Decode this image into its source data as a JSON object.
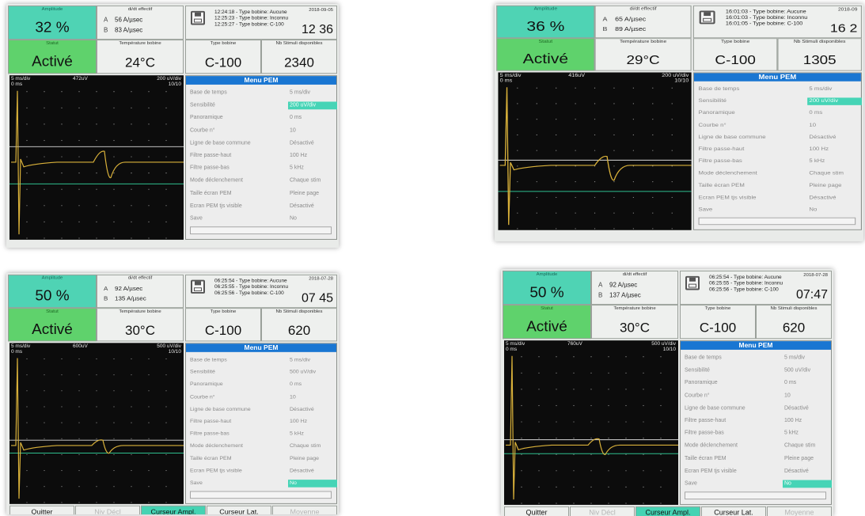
{
  "photos": [
    {
      "amplitude_label": "Amplitude",
      "amplitude_value": "32 %",
      "didt_label": "di/dt effectif",
      "didt_a_label": "A",
      "didt_a_value": "56 A/µsec",
      "didt_b_label": "B",
      "didt_b_value": "83 A/µsec",
      "log_lines": [
        "12:24:18 - Type bobine: Aucune",
        "12:25:23 - Type bobine: Inconnu",
        "12:25:27 - Type bobine: C-100"
      ],
      "log_date": "2018-09-05",
      "log_time": "12 36",
      "statut_label": "Statut",
      "statut_value": "Activé",
      "temp_label": "Température bobine",
      "temp_value": "24°C",
      "coil_label": "Type bobine",
      "coil_value": "C-100",
      "stimuli_label": "Nb Stimuli disponibles",
      "stimuli_value": "2340",
      "scope_timebase": "5 ms/div",
      "scope_zero": "0 ms",
      "scope_peak": "472uV",
      "scope_sens": "200 uV/div",
      "scope_count": "10/10",
      "menu_title": "Menu PEM",
      "menu_rows": [
        {
          "label": "Base de temps",
          "value": "5 ms/div"
        },
        {
          "label": "Sensibilité",
          "value": "200 uV/div"
        },
        {
          "label": "Panoramique",
          "value": "0 ms"
        },
        {
          "label": "Courbe n°",
          "value": "10"
        },
        {
          "label": "Ligne de base commune",
          "value": "Désactivé"
        },
        {
          "label": "Filtre passe-haut",
          "value": "100 Hz"
        },
        {
          "label": "Filtre passe-bas",
          "value": "5 kHz"
        },
        {
          "label": "Mode déclenchement",
          "value": "Chaque stim"
        },
        {
          "label": "Taille écran PEM",
          "value": "Pleine page"
        },
        {
          "label": "Ecran PEM tjs visible",
          "value": "Désactivé"
        },
        {
          "label": "Save",
          "value": "No"
        }
      ],
      "highlight_row": 1,
      "softkeys": []
    },
    {
      "amplitude_label": "Amplitude",
      "amplitude_value": "36 %",
      "didt_label": "di/dt effectif",
      "didt_a_label": "A",
      "didt_a_value": "65 A/µsec",
      "didt_b_label": "B",
      "didt_b_value": "89 A/µsec",
      "log_lines": [
        "16:01:03 - Type bobine: Aucune",
        "16:01:03 - Type bobine: Inconnu",
        "16:01:05 - Type bobine: C-100"
      ],
      "log_date": "2018-09",
      "log_time": "16 2",
      "statut_label": "Statut",
      "statut_value": "Activé",
      "temp_label": "Température bobine",
      "temp_value": "29°C",
      "coil_label": "Type bobine",
      "coil_value": "C-100",
      "stimuli_label": "Nb Stimuli disponibles",
      "stimuli_value": "1305",
      "scope_timebase": "5 ms/div",
      "scope_zero": "0 ms",
      "scope_peak": "416uV",
      "scope_sens": "200 uV/div",
      "scope_count": "10/10",
      "menu_title": "Menu PEM",
      "menu_rows": [
        {
          "label": "Base de temps",
          "value": "5 ms/div"
        },
        {
          "label": "Sensibilité",
          "value": "200 uV/div"
        },
        {
          "label": "Panoramique",
          "value": "0 ms"
        },
        {
          "label": "Courbe n°",
          "value": "10"
        },
        {
          "label": "Ligne de base commune",
          "value": "Désactivé"
        },
        {
          "label": "Filtre passe-haut",
          "value": "100 Hz"
        },
        {
          "label": "Filtre passe-bas",
          "value": "5 kHz"
        },
        {
          "label": "Mode déclenchement",
          "value": "Chaque stim"
        },
        {
          "label": "Taille écran PEM",
          "value": "Pleine page"
        },
        {
          "label": "Ecran PEM tjs visible",
          "value": "Désactivé"
        },
        {
          "label": "Save",
          "value": "No"
        }
      ],
      "highlight_row": 1,
      "softkeys": []
    },
    {
      "amplitude_label": "Amplitude",
      "amplitude_value": "50 %",
      "didt_label": "di/dt effectif",
      "didt_a_label": "A",
      "didt_a_value": "92 A/µsec",
      "didt_b_label": "B",
      "didt_b_value": "135 A/µsec",
      "log_lines": [
        "06:25:54 - Type bobine: Aucune",
        "06:25:55 - Type bobine: Inconnu",
        "06:25:56 - Type bobine: C-100"
      ],
      "log_date": "2018-07-28",
      "log_time": "07 45",
      "statut_label": "Statut",
      "statut_value": "Activé",
      "temp_label": "Température bobine",
      "temp_value": "30°C",
      "coil_label": "Type bobine",
      "coil_value": "C-100",
      "stimuli_label": "Nb Stimuli disponibles",
      "stimuli_value": "620",
      "scope_timebase": "5 ms/div",
      "scope_zero": "0 ms",
      "scope_peak": "600uV",
      "scope_sens": "500 uV/div",
      "scope_count": "10/10",
      "menu_title": "Menu PEM",
      "menu_rows": [
        {
          "label": "Base de temps",
          "value": "5 ms/div"
        },
        {
          "label": "Sensibilité",
          "value": "500 uV/div"
        },
        {
          "label": "Panoramique",
          "value": "0 ms"
        },
        {
          "label": "Courbe n°",
          "value": "10"
        },
        {
          "label": "Ligne de base commune",
          "value": "Désactivé"
        },
        {
          "label": "Filtre passe-haut",
          "value": "100 Hz"
        },
        {
          "label": "Filtre passe-bas",
          "value": "5 kHz"
        },
        {
          "label": "Mode déclenchement",
          "value": "Chaque stim"
        },
        {
          "label": "Taille écran PEM",
          "value": "Pleine page"
        },
        {
          "label": "Ecran PEM tjs visible",
          "value": "Désactivé"
        },
        {
          "label": "Save",
          "value": "No"
        }
      ],
      "highlight_row": 10,
      "softkeys": [
        {
          "label": "Quitter",
          "state": "normal"
        },
        {
          "label": "Niv Décl",
          "state": "disabled"
        },
        {
          "label": "Curseur Ampl.",
          "state": "active"
        },
        {
          "label": "Curseur Lat.",
          "state": "normal"
        },
        {
          "label": "Moyenne",
          "state": "disabled"
        }
      ]
    },
    {
      "amplitude_label": "Amplitude",
      "amplitude_value": "50 %",
      "didt_label": "di/dt effectif",
      "didt_a_label": "A",
      "didt_a_value": "92 A/µsec",
      "didt_b_label": "B",
      "didt_b_value": "137 A/µsec",
      "log_lines": [
        "06:25:54 - Type bobine: Aucune",
        "06:25:55 - Type bobine: Inconnu",
        "06:25:56 - Type bobine: C-100"
      ],
      "log_date": "2018-07-28",
      "log_time": "07:47",
      "statut_label": "Statut",
      "statut_value": "Activé",
      "temp_label": "Température bobine",
      "temp_value": "30°C",
      "coil_label": "Type bobine",
      "coil_value": "C-100",
      "stimuli_label": "Nb Stimuli disponibles",
      "stimuli_value": "620",
      "scope_timebase": "5 ms/div",
      "scope_zero": "0 ms",
      "scope_peak": "760uV",
      "scope_sens": "500 uV/div",
      "scope_count": "10/10",
      "menu_title": "Menu PEM",
      "menu_rows": [
        {
          "label": "Base de temps",
          "value": "5 ms/div"
        },
        {
          "label": "Sensibilité",
          "value": "500 uV/div"
        },
        {
          "label": "Panoramique",
          "value": "0 ms"
        },
        {
          "label": "Courbe n°",
          "value": "10"
        },
        {
          "label": "Ligne de base commune",
          "value": "Désactivé"
        },
        {
          "label": "Filtre passe-haut",
          "value": "100 Hz"
        },
        {
          "label": "Filtre passe-bas",
          "value": "5 kHz"
        },
        {
          "label": "Mode déclenchement",
          "value": "Chaque stim"
        },
        {
          "label": "Taille écran PEM",
          "value": "Pleine page"
        },
        {
          "label": "Ecran PEM tjs visible",
          "value": "Désactivé"
        },
        {
          "label": "Save",
          "value": "No"
        }
      ],
      "highlight_row": 10,
      "softkeys": [
        {
          "label": "Quitter",
          "state": "normal"
        },
        {
          "label": "Niv Décl",
          "state": "disabled"
        },
        {
          "label": "Curseur Ampl.",
          "state": "active"
        },
        {
          "label": "Curseur Lat.",
          "state": "normal"
        },
        {
          "label": "Moyenne",
          "state": "disabled"
        }
      ]
    }
  ]
}
